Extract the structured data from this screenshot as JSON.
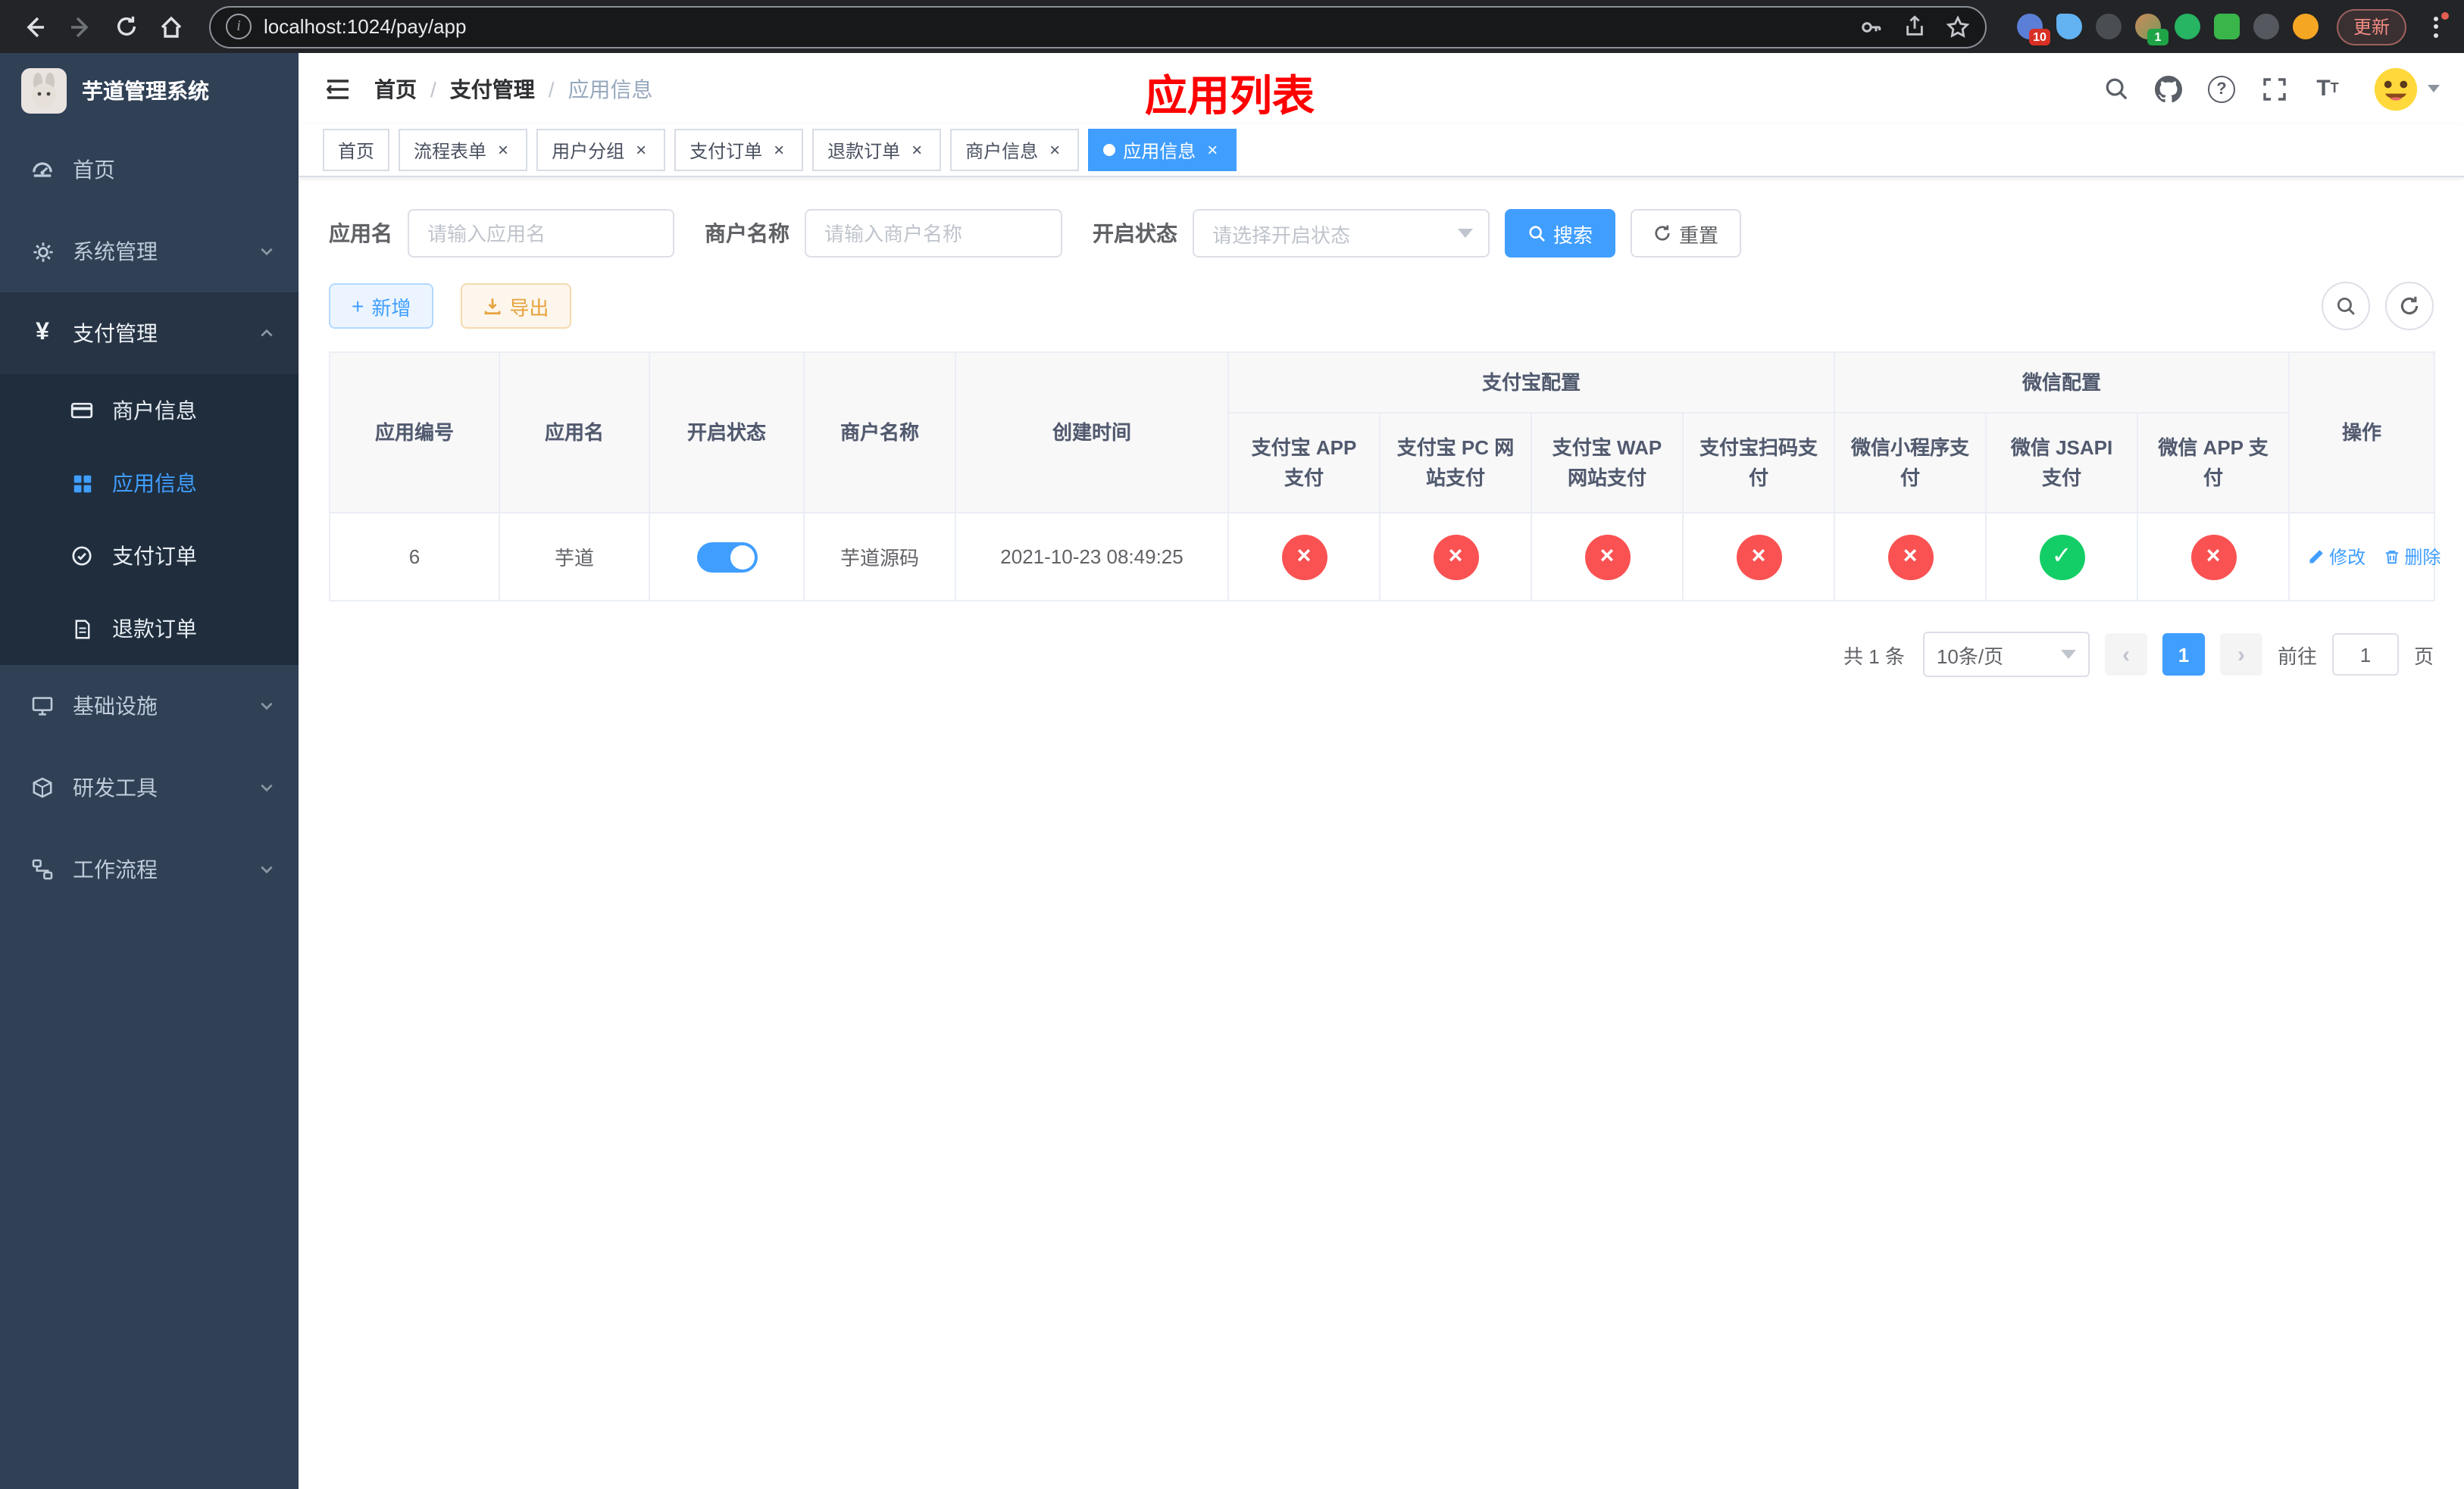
{
  "browser": {
    "url": "localhost:1024/pay/app",
    "update_label": "更新",
    "extensions": {
      "badge1": "10",
      "badge2": "1"
    }
  },
  "sidebar": {
    "logo_title": "芋道管理系统",
    "menu": [
      {
        "label": "首页"
      },
      {
        "label": "系统管理"
      },
      {
        "label": "支付管理"
      },
      {
        "label": "基础设施"
      },
      {
        "label": "研发工具"
      },
      {
        "label": "工作流程"
      }
    ],
    "payment_submenu": [
      {
        "label": "商户信息"
      },
      {
        "label": "应用信息"
      },
      {
        "label": "支付订单"
      },
      {
        "label": "退款订单"
      }
    ]
  },
  "header": {
    "breadcrumb": [
      "首页",
      "支付管理",
      "应用信息"
    ],
    "page_title": "应用列表"
  },
  "tabs": [
    {
      "label": "首页"
    },
    {
      "label": "流程表单"
    },
    {
      "label": "用户分组"
    },
    {
      "label": "支付订单"
    },
    {
      "label": "退款订单"
    },
    {
      "label": "商户信息"
    },
    {
      "label": "应用信息"
    }
  ],
  "filters": {
    "app_name_label": "应用名",
    "app_name_placeholder": "请输入应用名",
    "merchant_label": "商户名称",
    "merchant_placeholder": "请输入商户名称",
    "status_label": "开启状态",
    "status_placeholder": "请选择开启状态",
    "search_label": "搜索",
    "reset_label": "重置"
  },
  "toolbar": {
    "add_label": "新增",
    "export_label": "导出"
  },
  "table": {
    "headers": {
      "app_id": "应用编号",
      "app_name": "应用名",
      "status": "开启状态",
      "merchant": "商户名称",
      "created": "创建时间",
      "alipay_group": "支付宝配置",
      "wechat_group": "微信配置",
      "actions": "操作",
      "alipay_app": "支付宝 APP 支付",
      "alipay_pc": "支付宝 PC 网站支付",
      "alipay_wap": "支付宝 WAP 网站支付",
      "alipay_qr": "支付宝扫码支付",
      "wx_mini": "微信小程序支付",
      "wx_jsapi": "微信 JSAPI 支付",
      "wx_app": "微信 APP 支付"
    },
    "rows": [
      {
        "app_id": "6",
        "app_name": "芋道",
        "status_on": true,
        "merchant": "芋道源码",
        "created": "2021-10-23 08:49:25",
        "configs": {
          "alipay_app": false,
          "alipay_pc": false,
          "alipay_wap": false,
          "alipay_qr": false,
          "wx_mini": false,
          "wx_jsapi": true,
          "wx_app": false
        },
        "edit_label": "修改",
        "delete_label": "删除"
      }
    ]
  },
  "pagination": {
    "total_text": "共 1 条",
    "page_size": "10条/页",
    "current_page": "1",
    "goto_label": "前往",
    "goto_value": "1",
    "page_unit": "页"
  },
  "colors": {
    "primary": "#409eff",
    "fail": "#fa5252",
    "pass": "#13ce66",
    "title_red": "#ff0000"
  }
}
